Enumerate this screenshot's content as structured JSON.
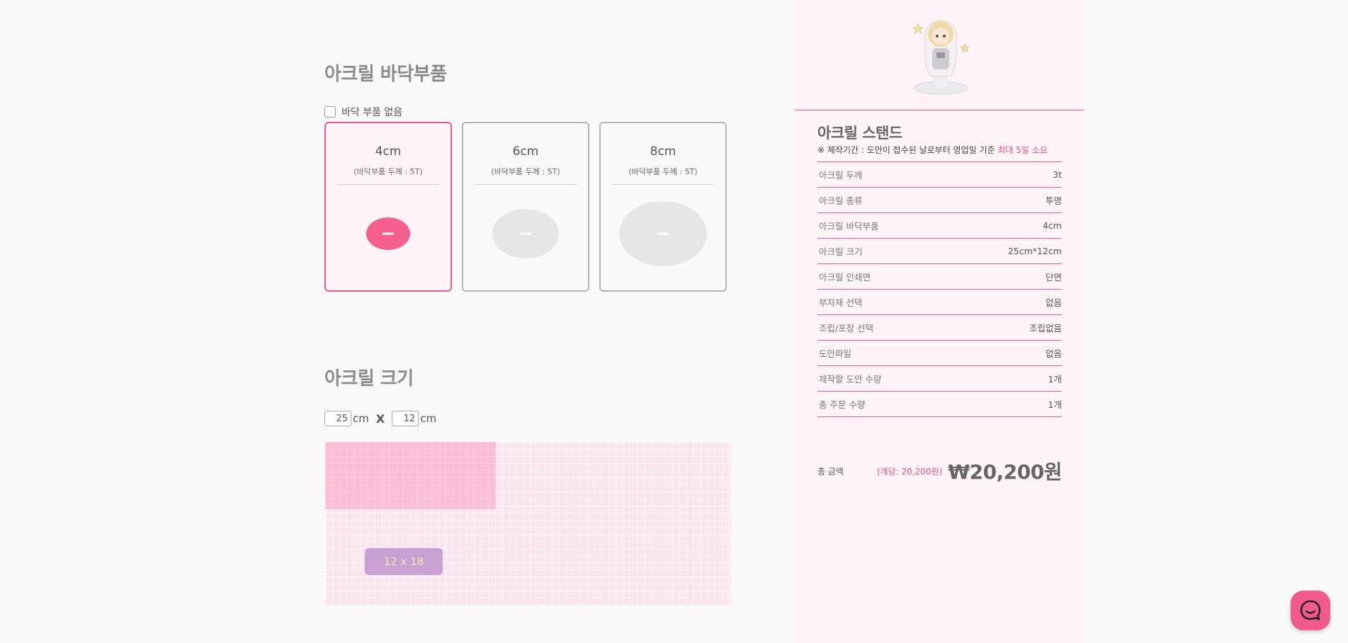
{
  "base_section": {
    "title": "아크릴 바닥부품",
    "no_base_label": "바닥 부품 없음",
    "options": [
      {
        "size": "4cm",
        "sub": "(바닥부품 두께 : 5T)",
        "selected": true
      },
      {
        "size": "6cm",
        "sub": "(바닥부품 두께 : 5T)",
        "selected": false
      },
      {
        "size": "8cm",
        "sub": "(바닥부품 두께 : 5T)",
        "selected": false
      }
    ]
  },
  "size_section": {
    "title": "아크릴 크기",
    "width_value": "25",
    "height_value": "12",
    "unit": "cm",
    "times": "X",
    "grid_tag": "12 x 18"
  },
  "summary": {
    "product_title": "아크릴 스탠드",
    "notice_prefix": "※ 제작기간 : 도안이 접수된 날로부터 영업일 기준 ",
    "notice_highlight": "최대 5일 소요",
    "specs": [
      {
        "label": "아크릴 두께",
        "value": "3t"
      },
      {
        "label": "아크릴 종류",
        "value": "투명"
      },
      {
        "label": "아크릴 바닥부품",
        "value": "4cm"
      },
      {
        "label": "아크릴 크기",
        "value": "25cm*12cm"
      },
      {
        "label": "아크릴 인쇄면",
        "value": "단면"
      },
      {
        "label": "부자재 선택",
        "value": "없음"
      },
      {
        "label": "조립/포장 선택",
        "value": "조립없음"
      },
      {
        "label": "도안파일",
        "value": "없음"
      },
      {
        "label": "제작할 도안 수량",
        "value": "1개"
      },
      {
        "label": "총 주문 수량",
        "value": "1개"
      }
    ],
    "total_label": "총 금액",
    "unit_price": "(개당: 20,200원)",
    "total_price": "₩20,200원"
  },
  "colors": {
    "accent": "#ef5a8c",
    "panel_bg": "#fff4f8"
  },
  "icons": {
    "chat": "chat-bubble-icon",
    "checkbox": "checkbox-icon"
  }
}
